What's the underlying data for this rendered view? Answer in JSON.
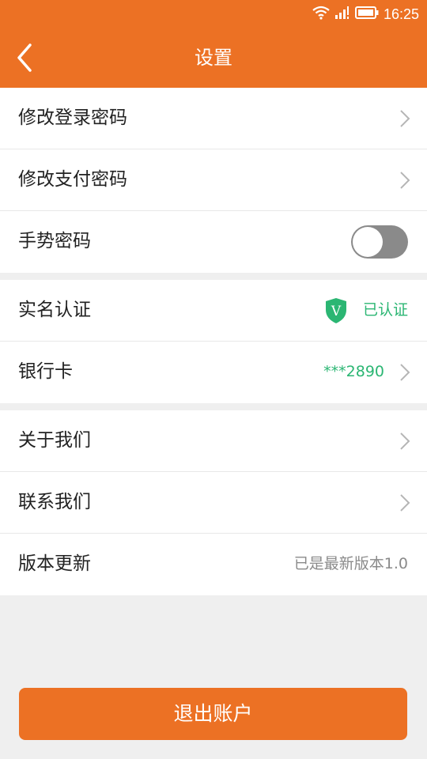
{
  "status_bar": {
    "time": "16:25"
  },
  "header": {
    "title": "设置"
  },
  "groups": [
    {
      "items": [
        {
          "label": "修改登录密码"
        },
        {
          "label": "修改支付密码"
        },
        {
          "label": "手势密码"
        }
      ]
    },
    {
      "items": [
        {
          "label": "实名认证",
          "value": "已认证",
          "badge_letter": "V"
        },
        {
          "label": "银行卡",
          "value": "***2890"
        }
      ]
    },
    {
      "items": [
        {
          "label": "关于我们"
        },
        {
          "label": "联系我们"
        },
        {
          "label": "版本更新",
          "value": "已是最新版本1.0"
        }
      ]
    }
  ],
  "gesture_toggle_on": false,
  "logout": {
    "label": "退出账户"
  },
  "colors": {
    "accent": "#ec7124",
    "verified_green": "#2bb673",
    "toggle_off": "#8a8a8a"
  },
  "icons": [
    "wifi-icon",
    "signal-icon",
    "battery-icon",
    "back-arrow-icon",
    "chevron-right-icon",
    "shield-check-icon"
  ]
}
